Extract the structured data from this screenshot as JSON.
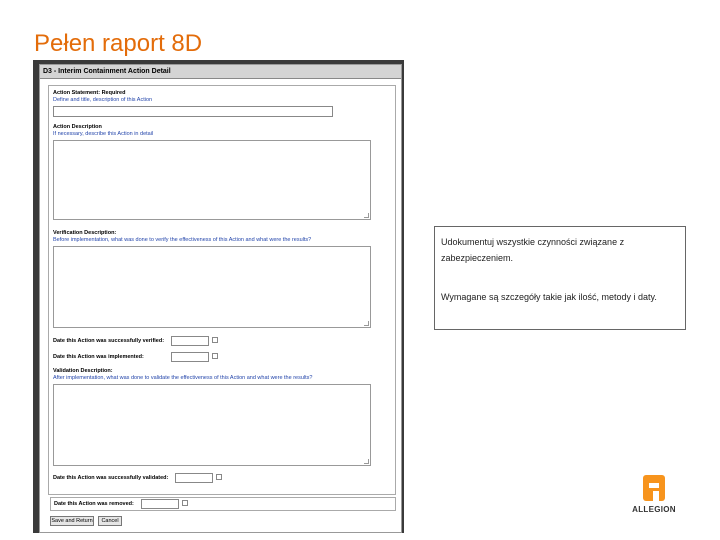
{
  "slide": {
    "title": "Pełen raport 8D"
  },
  "form": {
    "header": "D3 - Interim Containment Action Detail",
    "action_statement": {
      "label": "Action Statement: Required",
      "help": "Define and title, description of this Action",
      "value": ""
    },
    "action_description": {
      "label": "Action Description",
      "help": "If necessary, describe this Action in detail",
      "value": ""
    },
    "verification_description": {
      "label": "Verification Description:",
      "help": "Before implementation, what was done to verify the effectiveness of this Action and what were the results?",
      "value": ""
    },
    "date_verified": {
      "label": "Date this Action was successfully verified:",
      "value": ""
    },
    "date_implemented": {
      "label": "Date this Action was implemented:",
      "value": ""
    },
    "validation_description": {
      "label": "Validation Description:",
      "help": "After implementation, what was done to validate the effectiveness of this Action and what were the results?",
      "value": ""
    },
    "date_validated": {
      "label": "Date this Action was successfully validated:",
      "value": ""
    },
    "date_removed": {
      "label": "Date this Action was removed:",
      "value": ""
    },
    "buttons": {
      "save": "Save and Return",
      "cancel": "Cancel"
    }
  },
  "note": {
    "line1": "Udokumentuj wszystkie czynności związane z zabezpieczeniem.",
    "line2": "Wymagane są szczegóły takie jak ilość, metody i daty."
  },
  "logo": {
    "text": "ALLEGION"
  },
  "colors": {
    "title": "#e36c0a",
    "logo_orange": "#f7941d",
    "help_text": "#2244aa"
  }
}
